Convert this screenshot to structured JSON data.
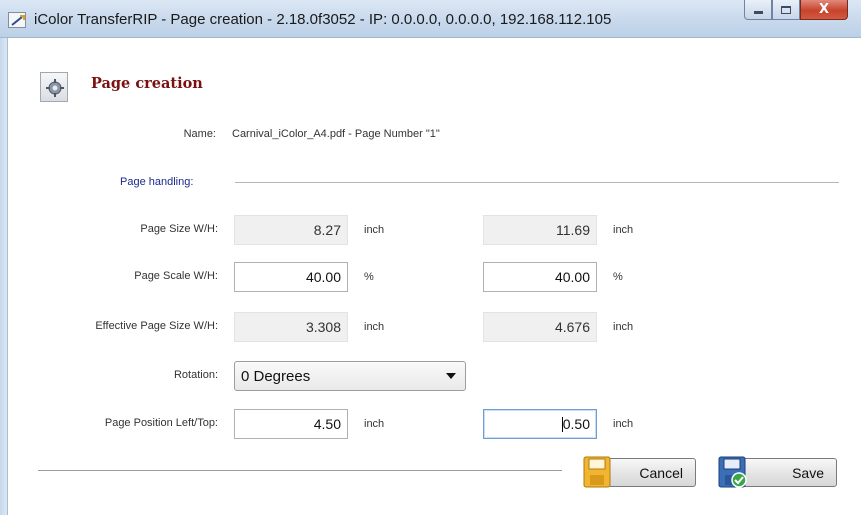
{
  "window": {
    "title": "iColor TransferRIP - Page creation - 2.18.0f3052 - IP: 0.0.0.0, 0.0.0.0, 192.168.112.105",
    "close_glyph": "X"
  },
  "header": {
    "title": "Page creation",
    "icon": "gear-document-icon"
  },
  "name_row": {
    "label": "Name:",
    "value": "Carnival_iColor_A4.pdf - Page Number \"1\""
  },
  "section": {
    "label": "Page handling:"
  },
  "rows": {
    "page_size": {
      "label": "Page Size W/H:",
      "width": "8.27",
      "height": "11.69",
      "unit_w": "inch",
      "unit_h": "inch"
    },
    "page_scale": {
      "label": "Page Scale W/H:",
      "width": "40.00",
      "height": "40.00",
      "unit_w": "%",
      "unit_h": "%"
    },
    "effective_size": {
      "label": "Effective Page Size W/H:",
      "width": "3.308",
      "height": "4.676",
      "unit_w": "inch",
      "unit_h": "inch"
    },
    "rotation": {
      "label": "Rotation:",
      "selected": "0 Degrees"
    },
    "position": {
      "label": "Page Position Left/Top:",
      "left": "4.50",
      "top": "0.50",
      "unit_l": "inch",
      "unit_t": "inch"
    }
  },
  "buttons": {
    "cancel": "Cancel",
    "save": "Save"
  },
  "colors": {
    "title_red": "#7a1010",
    "section_blue": "#1a2a8f",
    "focus_border": "#6f9ed6"
  }
}
